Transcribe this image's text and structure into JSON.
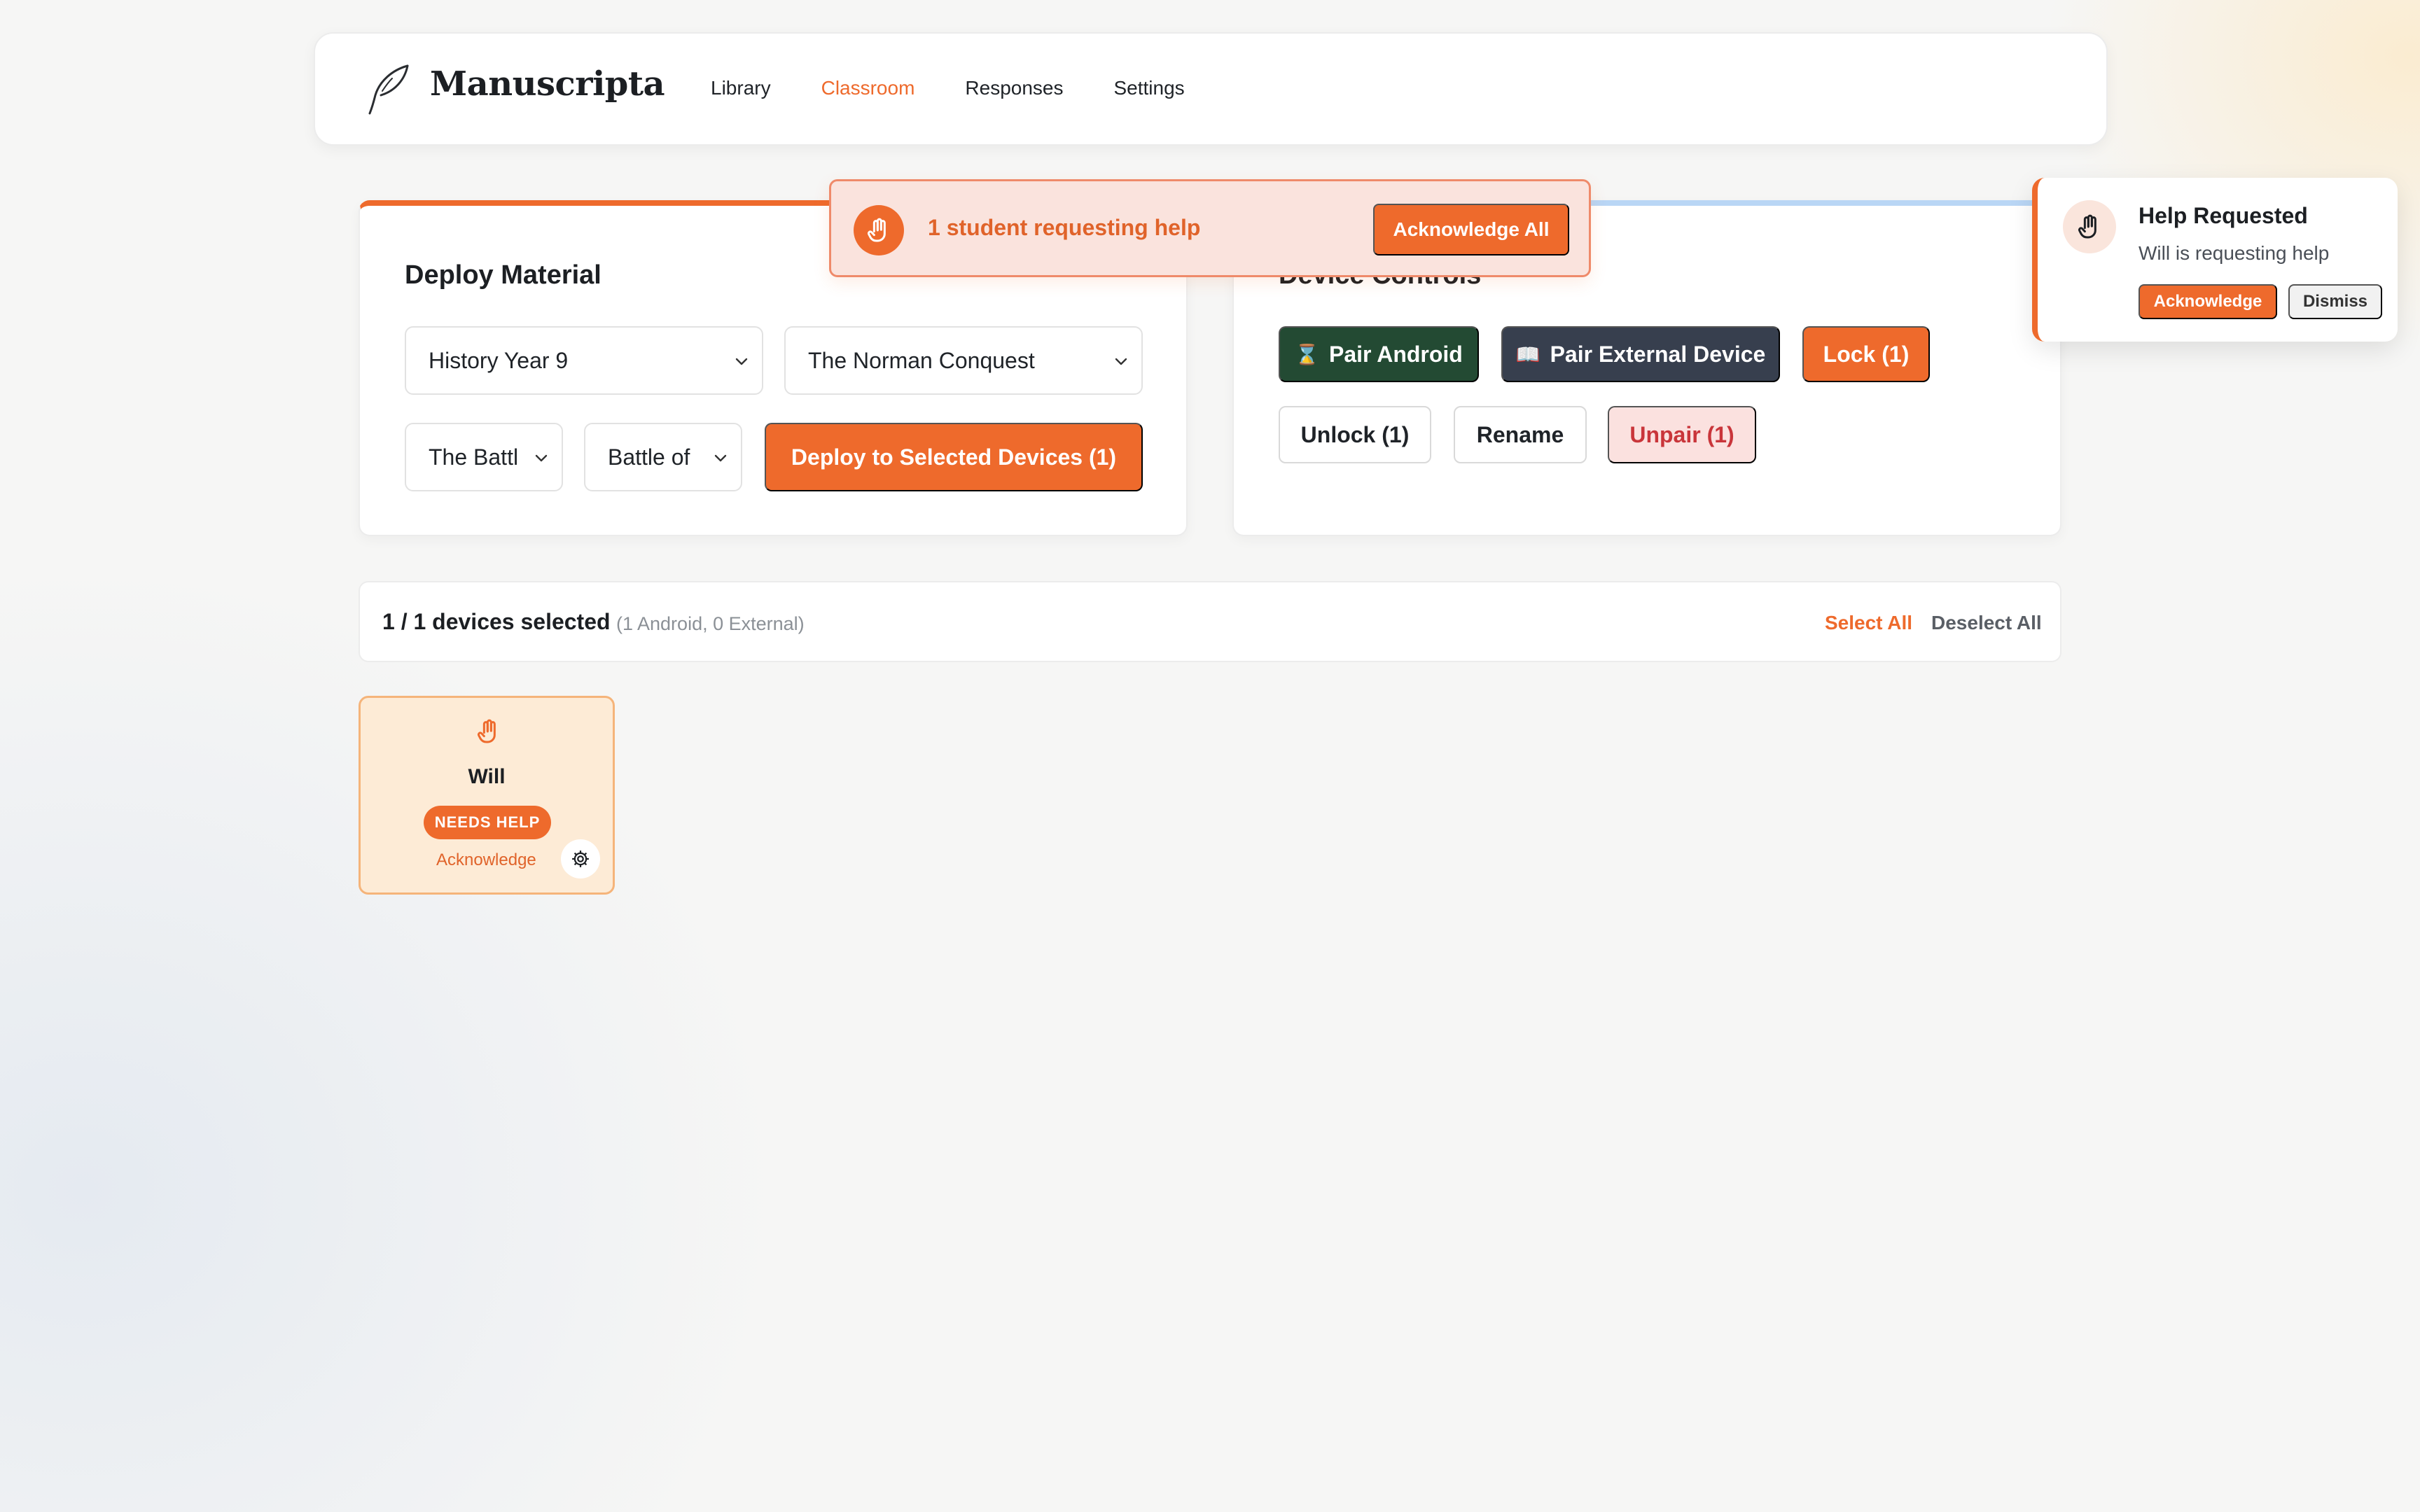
{
  "app": {
    "brand": "Manuscripta"
  },
  "nav": {
    "items": [
      {
        "label": "Library",
        "active": false
      },
      {
        "label": "Classroom",
        "active": true
      },
      {
        "label": "Responses",
        "active": false
      },
      {
        "label": "Settings",
        "active": false
      }
    ]
  },
  "deploy": {
    "title": "Deploy Material",
    "course": "History Year 9",
    "unit": "The Norman Conquest",
    "lesson": "The Battl",
    "material": "Battle of",
    "deploy_button": "Deploy to Selected Devices (1)"
  },
  "controls": {
    "title": "Device Controls",
    "pair_android": "Pair Android",
    "pair_android_icon": "⌛",
    "pair_external": "Pair External Device",
    "pair_external_icon": "📖",
    "lock": "Lock (1)",
    "unlock": "Unlock (1)",
    "rename": "Rename",
    "unpair": "Unpair (1)"
  },
  "banner": {
    "text": "1 student requesting help",
    "button": "Acknowledge All",
    "icon": "hand-icon"
  },
  "toast": {
    "title": "Help Requested",
    "message": "Will is requesting help",
    "acknowledge": "Acknowledge",
    "dismiss": "Dismiss",
    "icon": "hand-icon"
  },
  "selection": {
    "count": "1 / 1 devices selected",
    "detail": "(1 Android, 0 External)",
    "select_all": "Select All",
    "deselect_all": "Deselect All"
  },
  "devices": [
    {
      "name": "Will",
      "status": "NEEDS HELP",
      "action": "Acknowledge",
      "icon": "hand-icon"
    }
  ],
  "colors": {
    "accent": "#ee6a2c",
    "green": "#234a33",
    "slate": "#373f4e",
    "danger_text": "#c9353a",
    "danger_bg": "#fbe1df",
    "controls_accent": "#b9d6f5"
  }
}
